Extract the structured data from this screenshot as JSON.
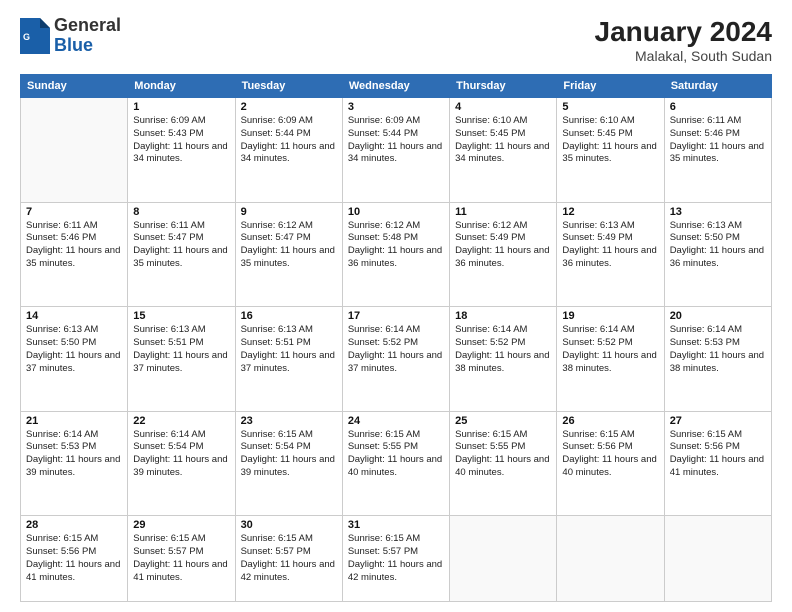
{
  "header": {
    "logo_general": "General",
    "logo_blue": "Blue",
    "month_year": "January 2024",
    "location": "Malakal, South Sudan"
  },
  "days_of_week": [
    "Sunday",
    "Monday",
    "Tuesday",
    "Wednesday",
    "Thursday",
    "Friday",
    "Saturday"
  ],
  "weeks": [
    [
      {
        "day": "",
        "sunrise": "",
        "sunset": "",
        "daylight": ""
      },
      {
        "day": "1",
        "sunrise": "6:09 AM",
        "sunset": "5:43 PM",
        "daylight": "11 hours and 34 minutes."
      },
      {
        "day": "2",
        "sunrise": "6:09 AM",
        "sunset": "5:44 PM",
        "daylight": "11 hours and 34 minutes."
      },
      {
        "day": "3",
        "sunrise": "6:09 AM",
        "sunset": "5:44 PM",
        "daylight": "11 hours and 34 minutes."
      },
      {
        "day": "4",
        "sunrise": "6:10 AM",
        "sunset": "5:45 PM",
        "daylight": "11 hours and 34 minutes."
      },
      {
        "day": "5",
        "sunrise": "6:10 AM",
        "sunset": "5:45 PM",
        "daylight": "11 hours and 35 minutes."
      },
      {
        "day": "6",
        "sunrise": "6:11 AM",
        "sunset": "5:46 PM",
        "daylight": "11 hours and 35 minutes."
      }
    ],
    [
      {
        "day": "7",
        "sunrise": "6:11 AM",
        "sunset": "5:46 PM",
        "daylight": "11 hours and 35 minutes."
      },
      {
        "day": "8",
        "sunrise": "6:11 AM",
        "sunset": "5:47 PM",
        "daylight": "11 hours and 35 minutes."
      },
      {
        "day": "9",
        "sunrise": "6:12 AM",
        "sunset": "5:47 PM",
        "daylight": "11 hours and 35 minutes."
      },
      {
        "day": "10",
        "sunrise": "6:12 AM",
        "sunset": "5:48 PM",
        "daylight": "11 hours and 36 minutes."
      },
      {
        "day": "11",
        "sunrise": "6:12 AM",
        "sunset": "5:49 PM",
        "daylight": "11 hours and 36 minutes."
      },
      {
        "day": "12",
        "sunrise": "6:13 AM",
        "sunset": "5:49 PM",
        "daylight": "11 hours and 36 minutes."
      },
      {
        "day": "13",
        "sunrise": "6:13 AM",
        "sunset": "5:50 PM",
        "daylight": "11 hours and 36 minutes."
      }
    ],
    [
      {
        "day": "14",
        "sunrise": "6:13 AM",
        "sunset": "5:50 PM",
        "daylight": "11 hours and 37 minutes."
      },
      {
        "day": "15",
        "sunrise": "6:13 AM",
        "sunset": "5:51 PM",
        "daylight": "11 hours and 37 minutes."
      },
      {
        "day": "16",
        "sunrise": "6:13 AM",
        "sunset": "5:51 PM",
        "daylight": "11 hours and 37 minutes."
      },
      {
        "day": "17",
        "sunrise": "6:14 AM",
        "sunset": "5:52 PM",
        "daylight": "11 hours and 37 minutes."
      },
      {
        "day": "18",
        "sunrise": "6:14 AM",
        "sunset": "5:52 PM",
        "daylight": "11 hours and 38 minutes."
      },
      {
        "day": "19",
        "sunrise": "6:14 AM",
        "sunset": "5:52 PM",
        "daylight": "11 hours and 38 minutes."
      },
      {
        "day": "20",
        "sunrise": "6:14 AM",
        "sunset": "5:53 PM",
        "daylight": "11 hours and 38 minutes."
      }
    ],
    [
      {
        "day": "21",
        "sunrise": "6:14 AM",
        "sunset": "5:53 PM",
        "daylight": "11 hours and 39 minutes."
      },
      {
        "day": "22",
        "sunrise": "6:14 AM",
        "sunset": "5:54 PM",
        "daylight": "11 hours and 39 minutes."
      },
      {
        "day": "23",
        "sunrise": "6:15 AM",
        "sunset": "5:54 PM",
        "daylight": "11 hours and 39 minutes."
      },
      {
        "day": "24",
        "sunrise": "6:15 AM",
        "sunset": "5:55 PM",
        "daylight": "11 hours and 40 minutes."
      },
      {
        "day": "25",
        "sunrise": "6:15 AM",
        "sunset": "5:55 PM",
        "daylight": "11 hours and 40 minutes."
      },
      {
        "day": "26",
        "sunrise": "6:15 AM",
        "sunset": "5:56 PM",
        "daylight": "11 hours and 40 minutes."
      },
      {
        "day": "27",
        "sunrise": "6:15 AM",
        "sunset": "5:56 PM",
        "daylight": "11 hours and 41 minutes."
      }
    ],
    [
      {
        "day": "28",
        "sunrise": "6:15 AM",
        "sunset": "5:56 PM",
        "daylight": "11 hours and 41 minutes."
      },
      {
        "day": "29",
        "sunrise": "6:15 AM",
        "sunset": "5:57 PM",
        "daylight": "11 hours and 41 minutes."
      },
      {
        "day": "30",
        "sunrise": "6:15 AM",
        "sunset": "5:57 PM",
        "daylight": "11 hours and 42 minutes."
      },
      {
        "day": "31",
        "sunrise": "6:15 AM",
        "sunset": "5:57 PM",
        "daylight": "11 hours and 42 minutes."
      },
      {
        "day": "",
        "sunrise": "",
        "sunset": "",
        "daylight": ""
      },
      {
        "day": "",
        "sunrise": "",
        "sunset": "",
        "daylight": ""
      },
      {
        "day": "",
        "sunrise": "",
        "sunset": "",
        "daylight": ""
      }
    ]
  ]
}
